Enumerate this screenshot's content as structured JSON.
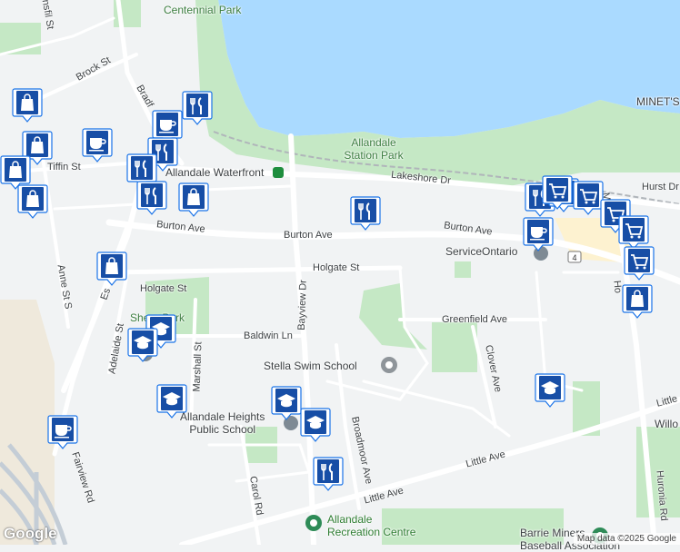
{
  "map": {
    "attribution": "Map data ©2025 Google",
    "logo": "Google",
    "colors": {
      "water": "#aadaff",
      "park": "#c5e8c5",
      "road": "#ffffff",
      "land": "#f1f3f4",
      "pin": "#1a73e8"
    }
  },
  "labels": {
    "centennial_park": "Centennial Park",
    "allandale_station_park": "Allandale Station Park",
    "lakeshore_dr": "Lakeshore Dr",
    "allandale_waterfront": "Allandale Waterfront",
    "burton_ave_1": "Burton Ave",
    "burton_ave_2": "Burton Ave",
    "burton_ave_3": "Burton Ave",
    "holgate_st_1": "Holgate St",
    "holgate_st_2": "Holgate St",
    "greenfield_ave": "Greenfield Ave",
    "baldwin_ln": "Baldwin Ln",
    "bayview_dr": "Bayview Dr",
    "stella_swim_school": "Stella Swim School",
    "serviceontario": "ServiceOntario",
    "allandale_heights_ps": "Allandale Heights\nPublic School",
    "broadmoor_ave": "Broadmoor Ave",
    "clover_ave": "Clover Ave",
    "little_ave_1": "Little Ave",
    "little_ave_2": "Little Ave",
    "little_ave_3": "Little",
    "allandale_rec": "Allandale\nRecreation Centre",
    "barrie_miners": "Barrie Miners\nBaseball Association",
    "minets": "MINET'S",
    "hurst_dr": "Hurst Dr",
    "huronia_rd": "Huronia Rd",
    "carol_rd": "Carol Rd",
    "fairview_rd": "Fairview Rd",
    "tiffin_st": "Tiffin St",
    "brock_st": "Brock St",
    "anne_st_s": "Anne St S",
    "adelaide_st": "Adelaide St",
    "marshall_st": "Marshall St",
    "shear_park": "Shear Park",
    "bradford": "Bradf",
    "essa": "Es",
    "ansfil": "nsfil St",
    "willow": "Willo",
    "ho": "Ho",
    "mine": "Mine",
    "route4": "4"
  },
  "pins": [
    {
      "name": "shopping-bag-icon",
      "kind": "bag"
    },
    {
      "name": "shopping-bag-icon",
      "kind": "bag"
    },
    {
      "name": "shopping-bag-icon",
      "kind": "bag"
    },
    {
      "name": "shopping-bag-icon",
      "kind": "bag"
    },
    {
      "name": "shopping-bag-icon",
      "kind": "bag"
    },
    {
      "name": "shopping-bag-icon",
      "kind": "bag"
    },
    {
      "name": "shopping-bag-icon",
      "kind": "bag"
    },
    {
      "name": "cafe-icon",
      "kind": "cafe"
    },
    {
      "name": "cafe-icon",
      "kind": "cafe"
    },
    {
      "name": "cafe-icon",
      "kind": "cafe"
    },
    {
      "name": "cafe-icon",
      "kind": "cafe"
    },
    {
      "name": "restaurant-icon",
      "kind": "fork"
    },
    {
      "name": "restaurant-icon",
      "kind": "fork"
    },
    {
      "name": "restaurant-icon",
      "kind": "fork"
    },
    {
      "name": "restaurant-icon",
      "kind": "fork"
    },
    {
      "name": "restaurant-icon",
      "kind": "fork"
    },
    {
      "name": "restaurant-icon",
      "kind": "fork"
    },
    {
      "name": "restaurant-icon",
      "kind": "fork"
    },
    {
      "name": "restaurant-icon",
      "kind": "fork"
    },
    {
      "name": "school-icon",
      "kind": "school"
    },
    {
      "name": "school-icon",
      "kind": "school"
    },
    {
      "name": "school-icon",
      "kind": "school"
    },
    {
      "name": "school-icon",
      "kind": "school"
    },
    {
      "name": "school-icon",
      "kind": "school"
    },
    {
      "name": "school-icon",
      "kind": "school"
    },
    {
      "name": "shopping-cart-icon",
      "kind": "cart"
    },
    {
      "name": "shopping-cart-icon",
      "kind": "cart"
    },
    {
      "name": "shopping-cart-icon",
      "kind": "cart"
    },
    {
      "name": "shopping-cart-icon",
      "kind": "cart"
    },
    {
      "name": "shopping-cart-icon",
      "kind": "cart"
    }
  ]
}
